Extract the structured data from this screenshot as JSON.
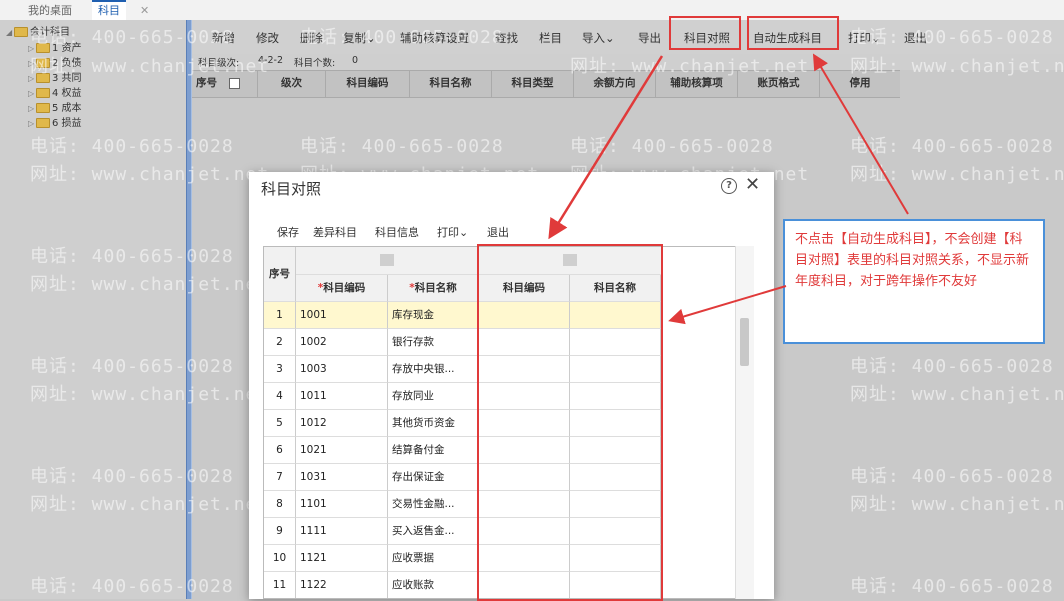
{
  "tabs": {
    "desktop": "我的桌面",
    "subject": "科目",
    "close": "✕"
  },
  "tree": {
    "root": "会计科目",
    "items": [
      "1 资产",
      "2 负债",
      "3 共同",
      "4 权益",
      "5 成本",
      "6 损益"
    ]
  },
  "toolbar": {
    "buttons": [
      "新增",
      "修改",
      "删除",
      "复制⌄",
      "辅助核算设置",
      "查找",
      "栏目",
      "导入⌄",
      "导出",
      "科目对照",
      "自动生成科目",
      "打印⌄",
      "退出"
    ]
  },
  "infobar": {
    "level_label": "科目级次:",
    "level_value": "4-2-2",
    "count_label": "科目个数:",
    "count_value": "0"
  },
  "grid": {
    "headers": [
      "序号",
      "级次",
      "科目编码",
      "科目名称",
      "科目类型",
      "余额方向",
      "辅助核算项",
      "账页格式",
      "停用"
    ]
  },
  "watermark": {
    "phone": "电话: 400-665-0028",
    "site": "网址: www.chanjet.net"
  },
  "dialog": {
    "title": "科目对照",
    "help_icon": "?",
    "close_icon": "✕",
    "toolbar": [
      "保存",
      "差异科目",
      "科目信息",
      "打印⌄",
      "退出"
    ],
    "head": {
      "seq": "序号",
      "code": "科目编码",
      "name": "科目名称",
      "new_code": "科目编码",
      "new_name": "科目名称",
      "req_mark": "*"
    },
    "rows": [
      {
        "seq": "1",
        "code": "1001",
        "name": "库存现金"
      },
      {
        "seq": "2",
        "code": "1002",
        "name": "银行存款"
      },
      {
        "seq": "3",
        "code": "1003",
        "name": "存放中央银..."
      },
      {
        "seq": "4",
        "code": "1011",
        "name": "存放同业"
      },
      {
        "seq": "5",
        "code": "1012",
        "name": "其他货币资金"
      },
      {
        "seq": "6",
        "code": "1021",
        "name": "结算备付金"
      },
      {
        "seq": "7",
        "code": "1031",
        "name": "存出保证金"
      },
      {
        "seq": "8",
        "code": "1101",
        "name": "交易性金融..."
      },
      {
        "seq": "9",
        "code": "1111",
        "name": "买入返售金..."
      },
      {
        "seq": "10",
        "code": "1121",
        "name": "应收票据"
      },
      {
        "seq": "11",
        "code": "1122",
        "name": "应收账款"
      }
    ]
  },
  "callout": {
    "text": "不点击【自动生成科目】，不会创建【科目对照】表里的科目对照关系，不显示新年度科目，对于跨年操作不友好"
  },
  "colors": {
    "highlight": "#e03a3a",
    "callout_border": "#4a90d9",
    "accent": "#1f5fb0"
  }
}
